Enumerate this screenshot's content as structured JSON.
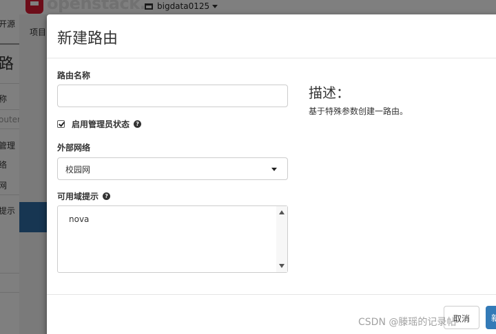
{
  "topbar": {
    "logo_text": "openstack.",
    "project_name": "bigdata0125"
  },
  "background": {
    "left_labels": [
      "开源",
      "路",
      "称",
      "outer",
      "管理",
      "络",
      "网",
      "提示"
    ],
    "nav_label": "项目"
  },
  "modal": {
    "title": "新建路由",
    "router_name_label": "路由名称",
    "router_name_value": "",
    "admin_state_label": "启用管理员状态",
    "admin_state_checked": true,
    "external_network_label": "外部网络",
    "external_network_value": "校园网",
    "az_hint_label": "可用域提示",
    "az_options": [
      "nova"
    ],
    "description_title": "描述：",
    "description_text": "基于特殊参数创建一路由。",
    "cancel_label": "取消",
    "submit_label": "新建路由"
  },
  "watermark": "CSDN @滕瑶的记录帖",
  "colors": {
    "primary_button": "#337ab7",
    "brand_red": "#da1a32"
  }
}
